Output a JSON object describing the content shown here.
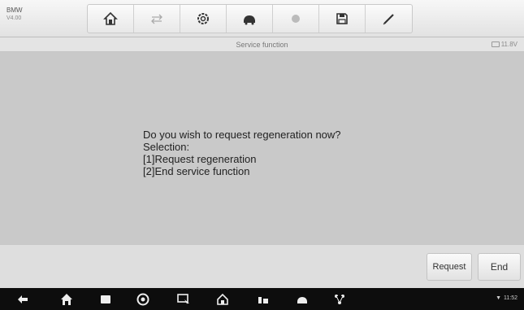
{
  "vehicle": {
    "make": "BMW",
    "model": "V4.00"
  },
  "toolbar": {
    "buttons": [
      {
        "icon": "home-icon"
      },
      {
        "icon": "vehicle-swap-icon"
      },
      {
        "icon": "settings-icon"
      },
      {
        "icon": "vehicle-menu-icon"
      },
      {
        "icon": "image-icon"
      },
      {
        "icon": "save-icon"
      },
      {
        "icon": "pen-icon"
      }
    ]
  },
  "titlebar": {
    "title": "Service function",
    "battery": "11.8V"
  },
  "dialog": {
    "message": "Do you wish to request regeneration now?\nSelection:\n[1]Request regeneration\n[2]End service function"
  },
  "footer": {
    "request_label": "Request",
    "end_label": "End"
  },
  "navbar": {
    "icons": [
      "back-icon",
      "home-icon",
      "recent-apps-icon",
      "chrome-icon",
      "screen-mirror-icon",
      "car-home-icon",
      "vehicle-icon",
      "vehicle-diag-icon",
      "network-icon"
    ],
    "status_text": "11:52"
  }
}
